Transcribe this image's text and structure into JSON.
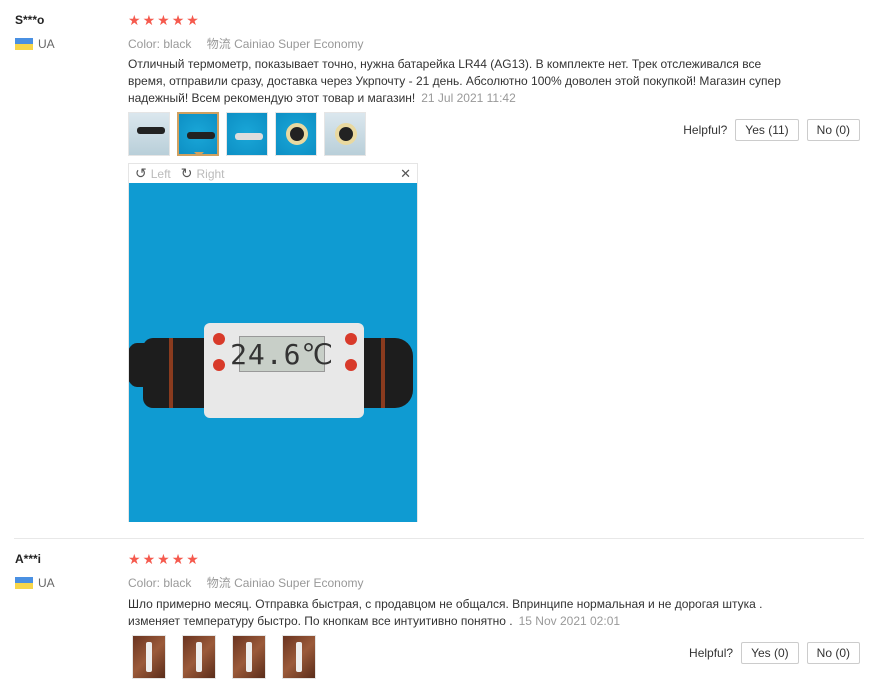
{
  "labels": {
    "color_key": "Color:",
    "shipping_key": "物流",
    "helpful": "Helpful?"
  },
  "viewer": {
    "left": "Left",
    "right": "Right",
    "display_reading": "24.6℃"
  },
  "reviews": [
    {
      "user": "S***o",
      "country": "UA",
      "rating": 5,
      "color": "black",
      "shipping": "Cainiao Super Economy",
      "text": "Отличный термометр, показывает точно, нужна батарейка LR44 (AG13). В комплекте нет. Трек отслеживался все время, отправили сразу, доставка через Укрпочту - 21 день. Абсолютно 100% доволен этой покупкой! Магазин супер надежный! Всем рекомендую этот товар и магазин!",
      "date": "21 Jul 2021 11:42",
      "yes": "Yes (11)",
      "no": "No (0)"
    },
    {
      "user": "A***i",
      "country": "UA",
      "rating": 5,
      "color": "black",
      "shipping": "Cainiao Super Economy",
      "text": "Шло примерно месяц. Отправка быстрая, с продавцом не общался. Впринципе нормальная и не дорогая штука . изменяет температуру быстро. По кнопкам все интуитивно понятно .",
      "date": "15 Nov 2021 02:01",
      "yes": "Yes (0)",
      "no": "No (0)"
    }
  ],
  "colors": {
    "star": "#f55a4e",
    "meta": "#999999"
  }
}
